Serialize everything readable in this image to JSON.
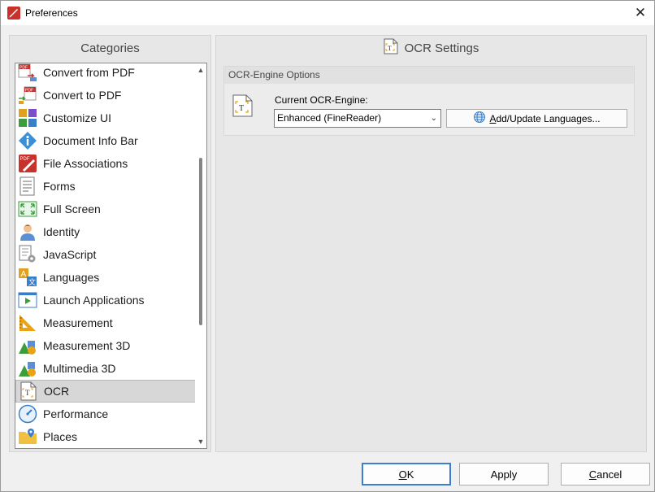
{
  "window": {
    "title": "Preferences"
  },
  "categories": {
    "header": "Categories",
    "items": [
      {
        "label": "Convert from PDF",
        "icon": "convert-from-pdf-icon"
      },
      {
        "label": "Convert to PDF",
        "icon": "convert-to-pdf-icon"
      },
      {
        "label": "Customize UI",
        "icon": "customize-ui-icon"
      },
      {
        "label": "Document Info Bar",
        "icon": "info-icon"
      },
      {
        "label": "File Associations",
        "icon": "file-associations-icon"
      },
      {
        "label": "Forms",
        "icon": "forms-icon"
      },
      {
        "label": "Full Screen",
        "icon": "full-screen-icon"
      },
      {
        "label": "Identity",
        "icon": "identity-icon"
      },
      {
        "label": "JavaScript",
        "icon": "javascript-icon"
      },
      {
        "label": "Languages",
        "icon": "languages-icon"
      },
      {
        "label": "Launch Applications",
        "icon": "launch-applications-icon"
      },
      {
        "label": "Measurement",
        "icon": "measurement-icon"
      },
      {
        "label": "Measurement 3D",
        "icon": "measurement-3d-icon"
      },
      {
        "label": "Multimedia 3D",
        "icon": "multimedia-3d-icon"
      },
      {
        "label": "OCR",
        "icon": "ocr-icon",
        "selected": true
      },
      {
        "label": "Performance",
        "icon": "performance-icon"
      },
      {
        "label": "Places",
        "icon": "places-icon"
      }
    ]
  },
  "settings": {
    "header": "OCR Settings",
    "group_title": "OCR-Engine Options",
    "engine_label": "Current OCR-Engine:",
    "engine_value": "Enhanced (FineReader)",
    "add_languages_first": "A",
    "add_languages_rest": "dd/Update Languages..."
  },
  "buttons": {
    "ok_first": "O",
    "ok_rest": "K",
    "apply": "Apply",
    "cancel_first": "C",
    "cancel_rest": "ancel"
  },
  "colors": {
    "accent": "#3c7fd2",
    "selection": "#d7d7d7",
    "pdf_red": "#c8322c"
  }
}
